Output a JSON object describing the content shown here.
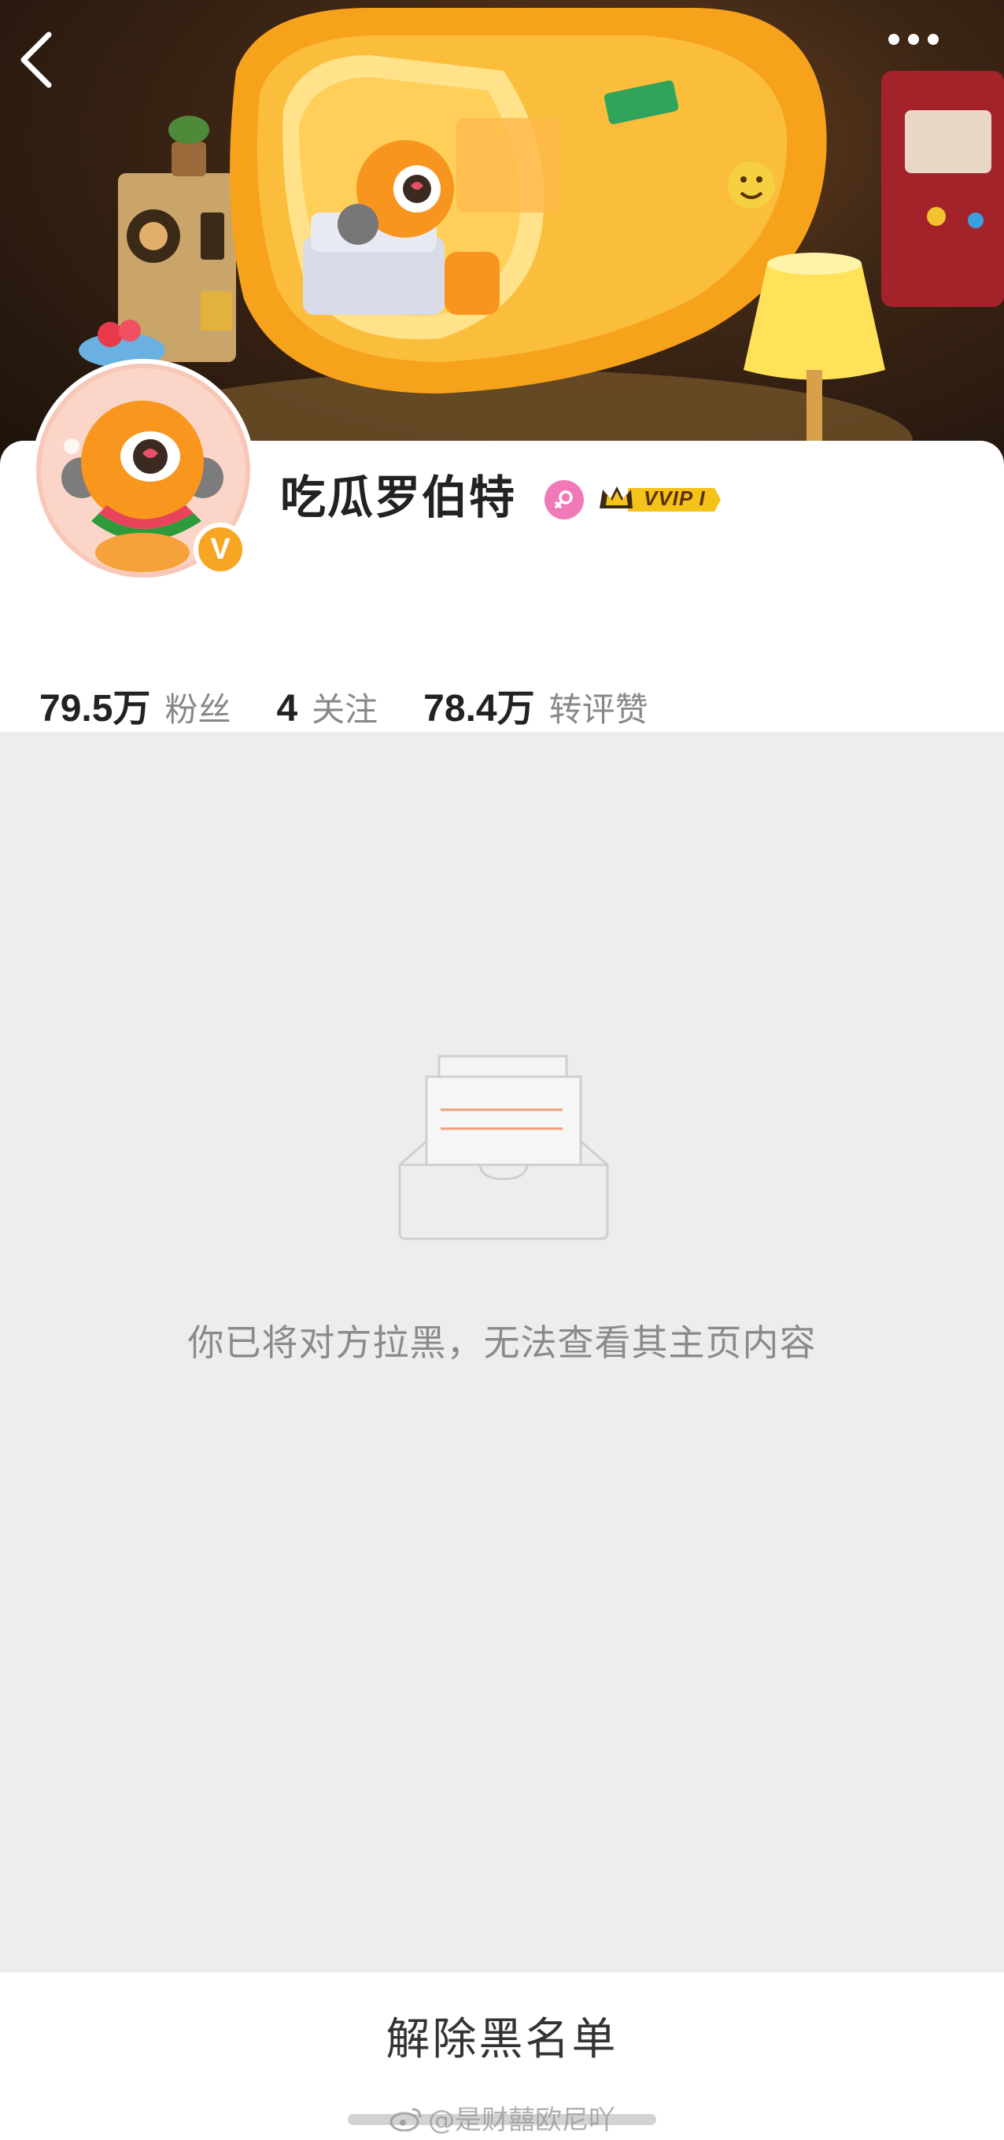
{
  "profile": {
    "username": "吃瓜罗伯特",
    "vip_label": "VVIP I",
    "verified_badge": "V"
  },
  "stats": [
    {
      "value": "79.5万",
      "label": "粉丝"
    },
    {
      "value": "4",
      "label": "关注"
    },
    {
      "value": "78.4万",
      "label": "转评赞"
    }
  ],
  "empty_state": {
    "message": "你已将对方拉黑，无法查看其主页内容"
  },
  "bottom_bar": {
    "unblock_label": "解除黑名单"
  },
  "watermark": "@是财囍欧尼吖",
  "icons": {
    "back": "back-arrow-icon",
    "more": "more-dots-icon",
    "gender": "female-icon",
    "vip": "vip-crown-icon",
    "empty": "empty-box-icon",
    "watermark": "weibo-logo-icon"
  },
  "colors": {
    "banner_orange": "#f7a21b",
    "vip_gold": "#f5c21a",
    "gender_pink": "#f07ab8",
    "badge_orange": "#f6a623",
    "page_bg": "#ededed"
  }
}
